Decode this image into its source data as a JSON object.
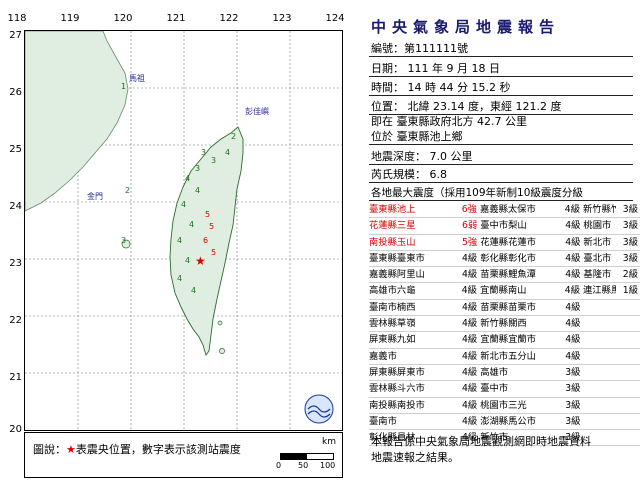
{
  "map": {
    "lon_ticks": [
      "118",
      "119",
      "120",
      "121",
      "122",
      "123",
      "124"
    ],
    "lat_ticks": [
      "27",
      "26",
      "25",
      "24",
      "23",
      "22",
      "21",
      "20"
    ],
    "place_labels": [
      "馬祖",
      "彭佳嶼",
      "金門"
    ],
    "intensity_marks": [
      "5",
      "5",
      "6",
      "5",
      "4",
      "4",
      "4",
      "4",
      "4",
      "4",
      "4",
      "4",
      "4",
      "3",
      "3",
      "3",
      "3",
      "2",
      "2",
      "1"
    ],
    "epicenter_color": "#e00000"
  },
  "legend": {
    "prefix": "圖說：",
    "star": "★",
    "text": "表震央位置，數字表示該測站震度",
    "scale_unit": "km",
    "scale_ticks": [
      "0",
      "50",
      "100"
    ]
  },
  "report": {
    "title": "中央氣象局地震報告",
    "number_label": "編號：",
    "number": "第111111號",
    "date_line": "日期： 111 年 9 月 18 日",
    "time_line": "時間： 14 時 44 分 15.2 秒",
    "location_line": "位置： 北緯 23.14 度，東經 121.2 度",
    "at_line": "即在 臺東縣政府北方 42.7 公里",
    "at_line2": "位於 臺東縣池上鄉",
    "depth_line": "地震深度： 7.0 公里",
    "magnitude_line": "芮氏規模： 6.8",
    "intensity_header": "各地最大震度（採用109年新制10級震度分級",
    "rows": [
      [
        [
          "臺東縣池上",
          "6強",
          "red"
        ],
        [
          "嘉義縣太保市",
          "4級",
          ""
        ],
        [
          "新竹縣竹北市",
          "3級",
          ""
        ]
      ],
      [
        [
          "花蓮縣三星",
          "6弱",
          "red"
        ],
        [
          "臺中市梨山",
          "4級",
          ""
        ],
        [
          "桃園市",
          "3級",
          ""
        ]
      ],
      [
        [
          "南投縣玉山",
          "5強",
          "red"
        ],
        [
          "花蓮縣花蓮市",
          "4級",
          ""
        ],
        [
          "新北市",
          "3級",
          ""
        ]
      ],
      [
        [
          "臺東縣臺東市",
          "4級",
          ""
        ],
        [
          "彰化縣彰化市",
          "4級",
          ""
        ],
        [
          "臺北市",
          "3級",
          ""
        ]
      ],
      [
        [
          "嘉義縣阿里山",
          "4級",
          ""
        ],
        [
          "苗栗縣鯉魚潭",
          "4級",
          ""
        ],
        [
          "基隆市",
          "2級",
          ""
        ]
      ],
      [
        [
          "高雄市六龜",
          "4級",
          ""
        ],
        [
          "宜蘭縣南山",
          "4級",
          ""
        ],
        [
          "連江縣馬祖",
          "1級",
          ""
        ]
      ],
      [
        [
          "臺南市楠西",
          "4級",
          ""
        ],
        [
          "苗栗縣苗栗市",
          "4級",
          ""
        ],
        [
          "",
          "",
          " "
        ]
      ],
      [
        [
          "雲林縣草嶺",
          "4級",
          ""
        ],
        [
          "新竹縣關西",
          "4級",
          ""
        ],
        [
          "",
          "",
          " "
        ]
      ],
      [
        [
          "屏東縣九如",
          "4級",
          ""
        ],
        [
          "宜蘭縣宜蘭市",
          "4級",
          ""
        ],
        [
          "",
          "",
          " "
        ]
      ],
      [
        [
          "嘉義市",
          "4級",
          ""
        ],
        [
          "新北市五分山",
          "4級",
          ""
        ],
        [
          "",
          "",
          " "
        ]
      ],
      [
        [
          "屏東縣屏東市",
          "4級",
          ""
        ],
        [
          "高雄市",
          "3級",
          ""
        ],
        [
          "",
          "",
          " "
        ]
      ],
      [
        [
          "雲林縣斗六市",
          "4級",
          ""
        ],
        [
          "臺中市",
          "3級",
          ""
        ],
        [
          "",
          "",
          " "
        ]
      ],
      [
        [
          "南投縣南投市",
          "4級",
          ""
        ],
        [
          "桃園市三光",
          "3級",
          ""
        ],
        [
          "",
          "",
          " "
        ]
      ],
      [
        [
          "臺南市",
          "4級",
          ""
        ],
        [
          "澎湖縣馬公市",
          "3級",
          ""
        ],
        [
          "",
          "",
          " "
        ]
      ],
      [
        [
          "彰化縣員林",
          "4級",
          ""
        ],
        [
          "新竹市",
          "3級",
          ""
        ],
        [
          "",
          "",
          " "
        ]
      ]
    ],
    "footer_line1": "本報告係中央氣象局地震觀測網即時地震資料",
    "footer_line2": "地震速報之結果。"
  }
}
